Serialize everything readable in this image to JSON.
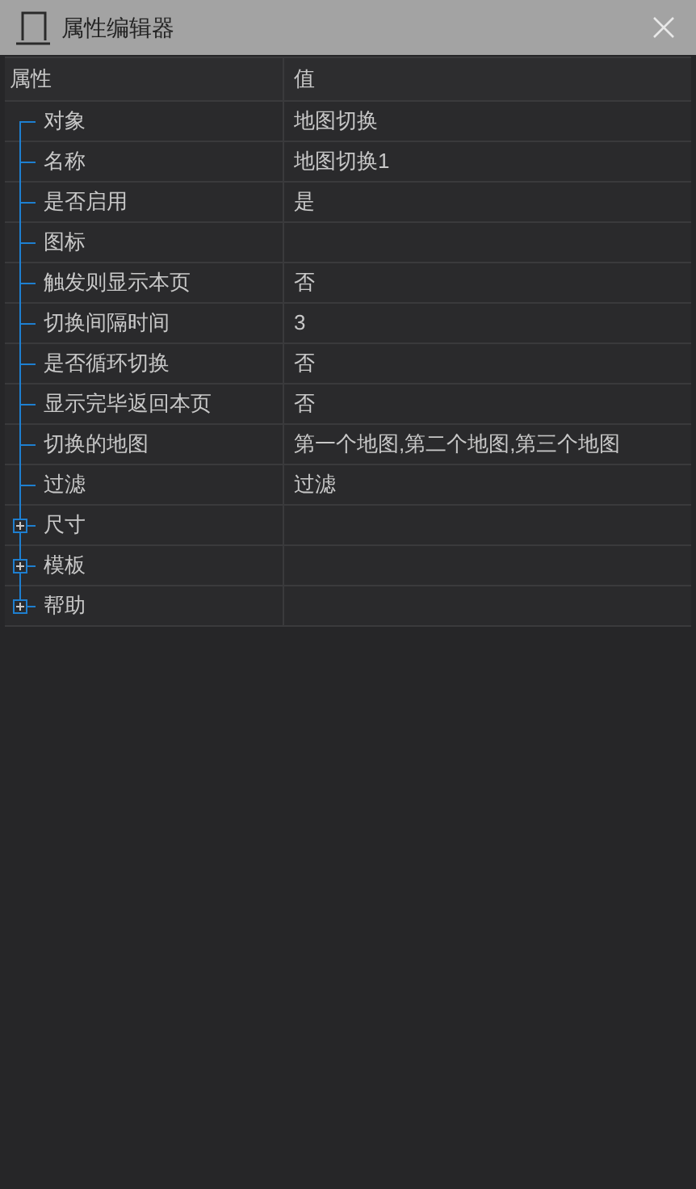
{
  "window": {
    "title": "属性编辑器"
  },
  "table": {
    "columns": [
      "属性",
      "值"
    ],
    "rows": [
      {
        "kind": "leaf",
        "name": "对象",
        "value": "地图切换"
      },
      {
        "kind": "leaf",
        "name": "名称",
        "value": "地图切换1"
      },
      {
        "kind": "leaf",
        "name": "是否启用",
        "value": "是"
      },
      {
        "kind": "leaf",
        "name": "图标"
      },
      {
        "kind": "leaf",
        "name": "触发则显示本页",
        "value": "否"
      },
      {
        "kind": "leaf",
        "name": "切换间隔时间",
        "value": "3"
      },
      {
        "kind": "leaf",
        "name": "是否循环切换",
        "value": "否"
      },
      {
        "kind": "leaf",
        "name": "显示完毕返回本页",
        "value": "否"
      },
      {
        "kind": "leaf",
        "name": "切换的地图",
        "value": "第一个地图,第二个地图,第三个地图"
      },
      {
        "kind": "leaf",
        "name": "过滤",
        "value": "过滤"
      },
      {
        "kind": "group",
        "name": "尺寸",
        "expanded": false
      },
      {
        "kind": "group",
        "name": "模板",
        "expanded": false
      },
      {
        "kind": "group",
        "name": "帮助",
        "expanded": false
      }
    ]
  }
}
